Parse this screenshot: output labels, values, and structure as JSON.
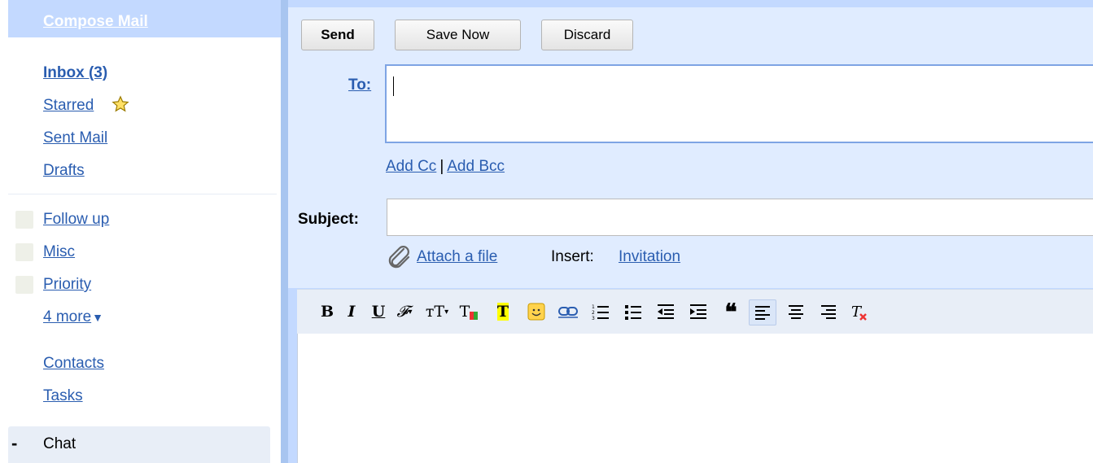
{
  "sidebar": {
    "compose": "Compose Mail",
    "nav": [
      {
        "label": "Inbox (3)",
        "bold": true
      },
      {
        "label": "Starred"
      },
      {
        "label": "Sent Mail"
      },
      {
        "label": "Drafts"
      }
    ],
    "labels": [
      "Follow up",
      "Misc",
      "Priority"
    ],
    "more": "4 more",
    "links": [
      "Contacts",
      "Tasks"
    ],
    "chat": {
      "toggle": "-",
      "label": "Chat"
    }
  },
  "compose": {
    "buttons": {
      "send": "Send",
      "save": "Save Now",
      "discard": "Discard"
    },
    "to_label": "To:",
    "to_value": "",
    "add_cc": "Add Cc",
    "separator": "|",
    "add_bcc": "Add Bcc",
    "subject_label": "Subject:",
    "subject_value": "",
    "attach": "Attach a file",
    "insert_label": "Insert:",
    "invitation": "Invitation"
  },
  "toolbar": {
    "bold": "B",
    "italic": "I",
    "underline": "U",
    "font": "𝓕",
    "size": "тT",
    "text_color": "T",
    "highlight": "T"
  },
  "colors": {
    "accent": "#c3d9ff",
    "panel": "#e0ecff",
    "link": "#2a5db0",
    "border": "#7ea4e4"
  }
}
